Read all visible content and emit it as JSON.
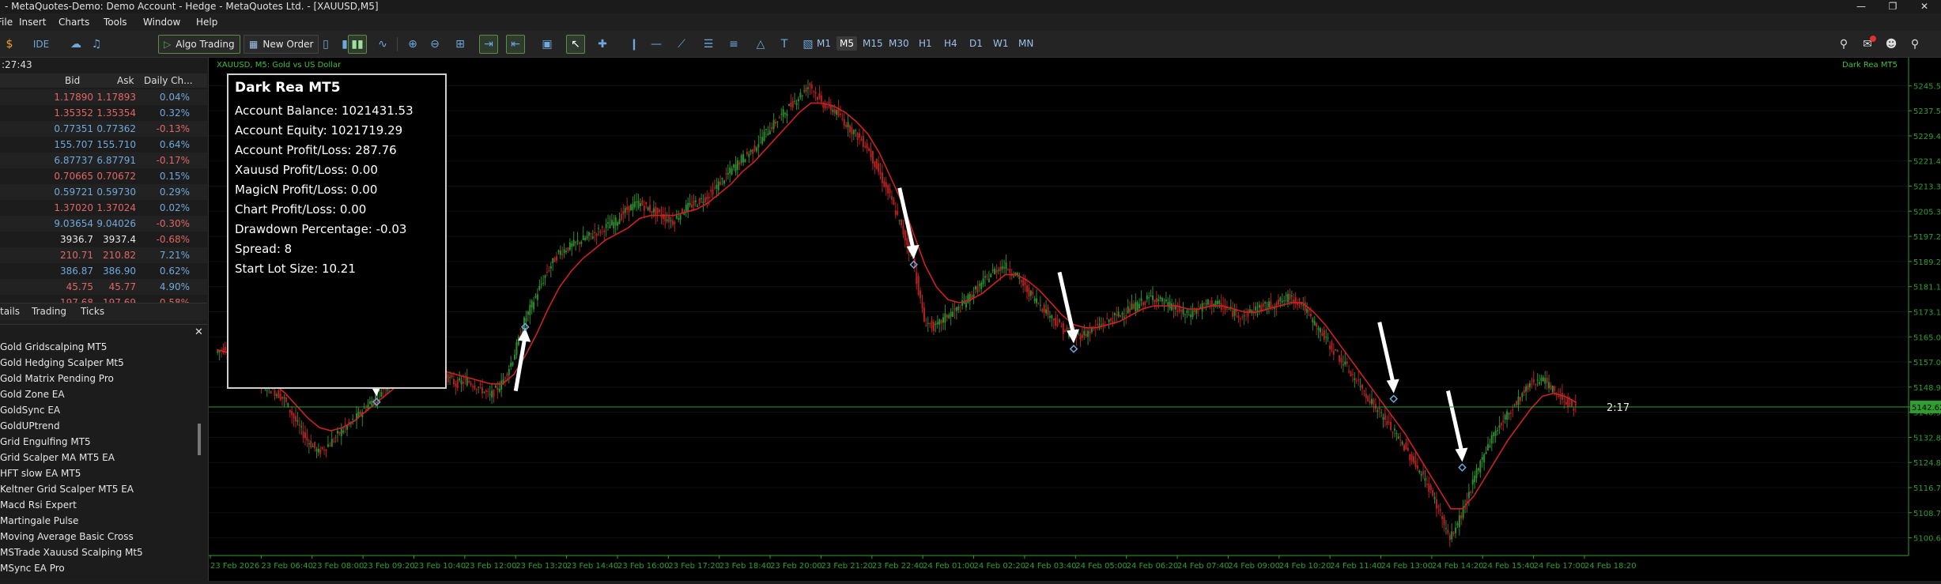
{
  "window": {
    "title": "- MetaQuotes-Demo: Demo Account - Hedge - MetaQuotes Ltd. - [XAUUSD,M5]"
  },
  "menu": [
    "File",
    "Insert",
    "Charts",
    "Tools",
    "Window",
    "Help"
  ],
  "toolbar": {
    "ide": "IDE",
    "algo_trading": "Algo Trading",
    "new_order": "New Order",
    "timeframes": [
      "M1",
      "M5",
      "M15",
      "M30",
      "H1",
      "H4",
      "D1",
      "W1",
      "MN"
    ],
    "active_timeframe": "M5"
  },
  "market_watch": {
    "time": ":27:43",
    "columns": [
      "Bid",
      "Ask",
      "Daily Ch..."
    ],
    "rows": [
      {
        "bid": "1.17890",
        "ask": "1.17893",
        "chg": "0.04%",
        "color": "#e06666",
        "chg_color": "#6fa8dc"
      },
      {
        "bid": "1.35352",
        "ask": "1.35354",
        "chg": "0.32%",
        "color": "#e06666",
        "chg_color": "#6fa8dc"
      },
      {
        "bid": "0.77351",
        "ask": "0.77362",
        "chg": "-0.13%",
        "color": "#6fa8dc",
        "chg_color": "#e06666"
      },
      {
        "bid": "155.707",
        "ask": "155.710",
        "chg": "0.64%",
        "color": "#6fa8dc",
        "chg_color": "#6fa8dc"
      },
      {
        "bid": "6.87737",
        "ask": "6.87791",
        "chg": "-0.17%",
        "color": "#6fa8dc",
        "chg_color": "#e06666"
      },
      {
        "bid": "0.70665",
        "ask": "0.70672",
        "chg": "0.15%",
        "color": "#e06666",
        "chg_color": "#6fa8dc"
      },
      {
        "bid": "0.59721",
        "ask": "0.59730",
        "chg": "0.29%",
        "color": "#6fa8dc",
        "chg_color": "#6fa8dc"
      },
      {
        "bid": "1.37020",
        "ask": "1.37024",
        "chg": "0.02%",
        "color": "#e06666",
        "chg_color": "#6fa8dc"
      },
      {
        "bid": "9.03654",
        "ask": "9.04026",
        "chg": "-0.30%",
        "color": "#6fa8dc",
        "chg_color": "#e06666"
      },
      {
        "bid": "3936.7",
        "ask": "3937.4",
        "chg": "-0.68%",
        "color": "#e6e6e6",
        "chg_color": "#e06666"
      },
      {
        "bid": "210.71",
        "ask": "210.82",
        "chg": "7.21%",
        "color": "#e06666",
        "chg_color": "#6fa8dc"
      },
      {
        "bid": "386.87",
        "ask": "386.90",
        "chg": "0.62%",
        "color": "#6fa8dc",
        "chg_color": "#6fa8dc"
      },
      {
        "bid": "45.75",
        "ask": "45.77",
        "chg": "4.90%",
        "color": "#e06666",
        "chg_color": "#6fa8dc"
      },
      {
        "bid": "197.68",
        "ask": "197.69",
        "chg": "-0.58%",
        "color": "#e06666",
        "chg_color": "#e06666"
      }
    ],
    "tabs": [
      "tails",
      "Trading",
      "Ticks"
    ]
  },
  "navigator": {
    "items": [
      "Gold Gridscalping MT5",
      "Gold Hedging Scalper Mt5",
      "Gold Matrix Pending Pro",
      "Gold Zone EA",
      "GoldSync EA",
      "GoldUPtrend",
      "Grid Engulfing MT5",
      "Grid Scalper MA MT5 EA",
      "HFT slow EA MT5",
      "Keltner Grid Scalper MT5 EA",
      "Macd Rsi Expert",
      "Martingale Pulse",
      "Moving Average Basic Cross",
      "MSTrade Xauusd Scalping Mt5",
      "MSync EA Pro"
    ]
  },
  "chart": {
    "symbol_label": "XAUUSD, M5:  Gold vs US Dollar",
    "ea_label": "Dark Rea MT5",
    "countdown": "2:17",
    "price_tag": "5142.62",
    "info_panel": {
      "title": "Dark Rea MT5",
      "lines": [
        "Account Balance: 1021431.53",
        "Account Equity: 1021719.29",
        "Account Profit/Loss: 287.76",
        "Xauusd Profit/Loss: 0.00",
        "MagicN Profit/Loss: 0.00",
        "Chart Profit/Loss: 0.00",
        "Drawdown Percentage: -0.03",
        "Spread: 8",
        "Start Lot Size: 10.21"
      ]
    }
  },
  "chart_data": {
    "type": "line",
    "title": "",
    "ylabel": "",
    "xlabel": "",
    "ylim": [
      5095,
      5252
    ],
    "y_ticks": [
      "5245.50",
      "5237.53",
      "5229.48",
      "5221.43",
      "5213.38",
      "5205.33",
      "5197.28",
      "5189.23",
      "5181.18",
      "5173.13",
      "5165.08",
      "5157.03",
      "5148.98",
      "5140.93",
      "5132.88",
      "5124.83",
      "5116.78",
      "5108.73",
      "5100.68"
    ],
    "x_ticks": [
      "23 Feb 2026",
      "23 Feb 06:40",
      "23 Feb 08:00",
      "23 Feb 09:20",
      "23 Feb 10:40",
      "23 Feb 12:00",
      "23 Feb 13:20",
      "23 Feb 14:40",
      "23 Feb 16:00",
      "23 Feb 17:20",
      "23 Feb 18:40",
      "23 Feb 20:00",
      "23 Feb 21:20",
      "23 Feb 22:40",
      "24 Feb 01:00",
      "24 Feb 02:20",
      "24 Feb 03:40",
      "24 Feb 05:00",
      "24 Feb 06:20",
      "24 Feb 07:40",
      "24 Feb 09:00",
      "24 Feb 10:20",
      "24 Feb 11:40",
      "24 Feb 13:00",
      "24 Feb 14:20",
      "24 Feb 15:40",
      "24 Feb 17:00",
      "24 Feb 18:20"
    ],
    "series": [
      {
        "kind": "price",
        "color": "#2e8b2e",
        "down_color": "#b22222",
        "values": [
          5160,
          5162,
          5158,
          5155,
          5150,
          5148,
          5145,
          5138,
          5132,
          5128,
          5131,
          5135,
          5138,
          5142,
          5146,
          5150,
          5152,
          5155,
          5154,
          5156,
          5153,
          5150,
          5151,
          5149,
          5146,
          5150,
          5158,
          5170,
          5178,
          5186,
          5192,
          5194,
          5196,
          5198,
          5200,
          5202,
          5206,
          5208,
          5206,
          5204,
          5202,
          5206,
          5208,
          5210,
          5214,
          5218,
          5222,
          5225,
          5230,
          5234,
          5238,
          5242,
          5246,
          5240,
          5238,
          5234,
          5230,
          5226,
          5218,
          5210,
          5200,
          5190,
          5170,
          5168,
          5172,
          5174,
          5178,
          5182,
          5186,
          5188,
          5185,
          5180,
          5176,
          5172,
          5168,
          5165,
          5166,
          5168,
          5170,
          5172,
          5174,
          5176,
          5178,
          5176,
          5174,
          5172,
          5174,
          5176,
          5175,
          5173,
          5172,
          5174,
          5175,
          5176,
          5178,
          5176,
          5170,
          5165,
          5160,
          5155,
          5150,
          5145,
          5140,
          5135,
          5130,
          5124,
          5118,
          5110,
          5100,
          5108,
          5118,
          5128,
          5135,
          5140,
          5145,
          5150,
          5152,
          5148,
          5145,
          5142
        ]
      },
      {
        "kind": "moving-average",
        "color": "#cc2222",
        "values": [
          5161,
          5160,
          5158,
          5156,
          5153,
          5150,
          5147,
          5143,
          5139,
          5136,
          5135,
          5136,
          5138,
          5141,
          5144,
          5147,
          5150,
          5152,
          5153,
          5154,
          5154,
          5153,
          5152,
          5151,
          5150,
          5150,
          5153,
          5159,
          5166,
          5174,
          5181,
          5186,
          5190,
          5193,
          5196,
          5198,
          5200,
          5203,
          5204,
          5204,
          5204,
          5205,
          5206,
          5208,
          5211,
          5214,
          5218,
          5221,
          5225,
          5229,
          5233,
          5237,
          5240,
          5240,
          5239,
          5237,
          5234,
          5230,
          5224,
          5216,
          5208,
          5198,
          5188,
          5181,
          5177,
          5176,
          5177,
          5179,
          5182,
          5185,
          5185,
          5183,
          5180,
          5176,
          5172,
          5169,
          5168,
          5168,
          5169,
          5170,
          5172,
          5174,
          5175,
          5175,
          5175,
          5174,
          5174,
          5175,
          5175,
          5174,
          5173,
          5173,
          5174,
          5175,
          5176,
          5176,
          5173,
          5169,
          5164,
          5159,
          5154,
          5149,
          5144,
          5139,
          5134,
          5128,
          5122,
          5116,
          5110,
          5110,
          5114,
          5120,
          5126,
          5132,
          5137,
          5142,
          5146,
          5147,
          5146,
          5144
        ]
      }
    ],
    "current_price": 5142.62,
    "arrows": [
      {
        "index": 14,
        "price": 5146,
        "direction": "down"
      },
      {
        "index": 27,
        "price": 5168,
        "direction": "up"
      },
      {
        "index": 61,
        "price": 5190,
        "direction": "down"
      },
      {
        "index": 75,
        "price": 5163,
        "direction": "down"
      },
      {
        "index": 103,
        "price": 5147,
        "direction": "down"
      },
      {
        "index": 109,
        "price": 5125,
        "direction": "down"
      }
    ]
  }
}
